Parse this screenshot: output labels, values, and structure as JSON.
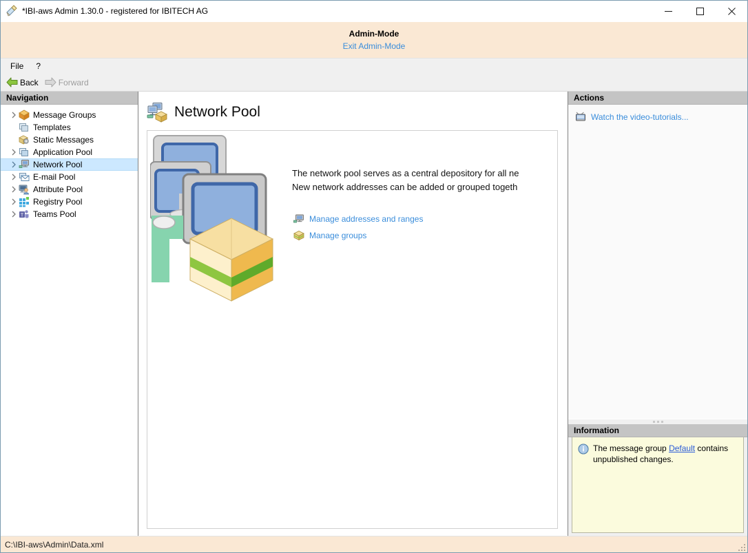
{
  "window": {
    "title": "*IBI-aws Admin 1.30.0 - registered for IBITECH AG",
    "icon": "pen-document-icon",
    "minimize_label": "Minimize",
    "maximize_label": "Maximize",
    "close_label": "Close"
  },
  "admin_banner": {
    "title": "Admin-Mode",
    "exit_link": "Exit Admin-Mode"
  },
  "menu": {
    "items": [
      {
        "label": "File"
      },
      {
        "label": "?"
      }
    ]
  },
  "toolbar": {
    "back_label": "Back",
    "forward_label": "Forward",
    "back_icon": "arrow-left-green-icon",
    "forward_icon": "arrow-right-grey-icon"
  },
  "navigation": {
    "header": "Navigation",
    "items": [
      {
        "label": "Message Groups",
        "icon": "package-orange-icon",
        "expandable": true,
        "selected": false
      },
      {
        "label": "Templates",
        "icon": "windows-stack-icon",
        "expandable": false,
        "selected": false
      },
      {
        "label": "Static Messages",
        "icon": "package-gear-icon",
        "expandable": false,
        "selected": false
      },
      {
        "label": "Application Pool",
        "icon": "windows-blue-icon",
        "expandable": true,
        "selected": false
      },
      {
        "label": "Network Pool",
        "icon": "monitor-network-icon",
        "expandable": true,
        "selected": true
      },
      {
        "label": "E-mail Pool",
        "icon": "envelope-icon",
        "expandable": true,
        "selected": false
      },
      {
        "label": "Attribute Pool",
        "icon": "user-monitor-icon",
        "expandable": true,
        "selected": false
      },
      {
        "label": "Registry Pool",
        "icon": "registry-grid-icon",
        "expandable": true,
        "selected": false
      },
      {
        "label": "Teams Pool",
        "icon": "teams-icon",
        "expandable": true,
        "selected": false
      }
    ]
  },
  "page": {
    "title": "Network Pool",
    "icon": "network-pool-icon",
    "illustration": "network-monitors-with-package-illustration",
    "description_line1": "The network pool serves as a central depository for all ne",
    "description_line2": "New network addresses can be added or grouped togeth",
    "task_links": [
      {
        "label": "Manage addresses and ranges",
        "icon": "monitor-network-icon"
      },
      {
        "label": "Manage groups",
        "icon": "package-yellow-icon"
      }
    ]
  },
  "actions": {
    "header": "Actions",
    "items": [
      {
        "label": "Watch the video-tutorials...",
        "icon": "television-icon"
      }
    ]
  },
  "information": {
    "header": "Information",
    "icon": "info-circle-icon",
    "text_before": "The message group ",
    "link": "Default",
    "text_after": " contains unpublished changes."
  },
  "statusbar": {
    "path": "C:\\IBI-aws\\Admin\\Data.xml"
  },
  "colors": {
    "admin_banner_bg": "#fae8d4",
    "link_blue": "#3a8ddb",
    "selection_blue": "#cce8ff",
    "pane_header_bg": "#c4c4c4",
    "info_bg": "#fbfbdd",
    "window_border": "#7a9bb0"
  }
}
